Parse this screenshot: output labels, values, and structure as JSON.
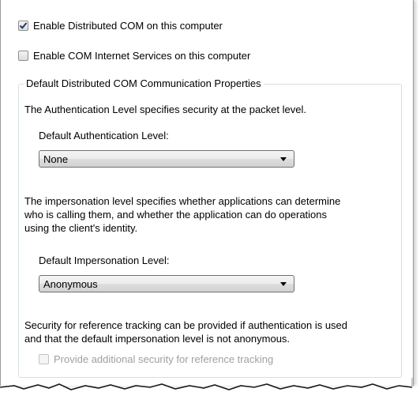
{
  "enable_dcom": {
    "label": "Enable Distributed COM on this computer",
    "checked": true
  },
  "enable_cis": {
    "label": "Enable COM Internet Services on this computer",
    "checked": false
  },
  "group": {
    "title": "Default Distributed COM Communication Properties",
    "auth_description": "The Authentication Level specifies security at the packet level.",
    "auth_label": "Default Authentication Level:",
    "auth_value": "None",
    "imp_description_line1": "The impersonation level specifies whether applications can determine",
    "imp_description_line2": "who is calling them, and whether the application can do operations",
    "imp_description_line3": "using the client's identity.",
    "imp_label": "Default Impersonation Level:",
    "imp_value": "Anonymous",
    "ref_description_line1": "Security for reference tracking can be provided if authentication is used",
    "ref_description_line2": "and that the default impersonation level is not anonymous.",
    "ref_checkbox": {
      "label": "Provide additional security for reference tracking",
      "checked": false,
      "enabled": false
    }
  },
  "icons": {
    "checkmark": "checkmark-icon",
    "dropdown": "chevron-down-icon"
  }
}
